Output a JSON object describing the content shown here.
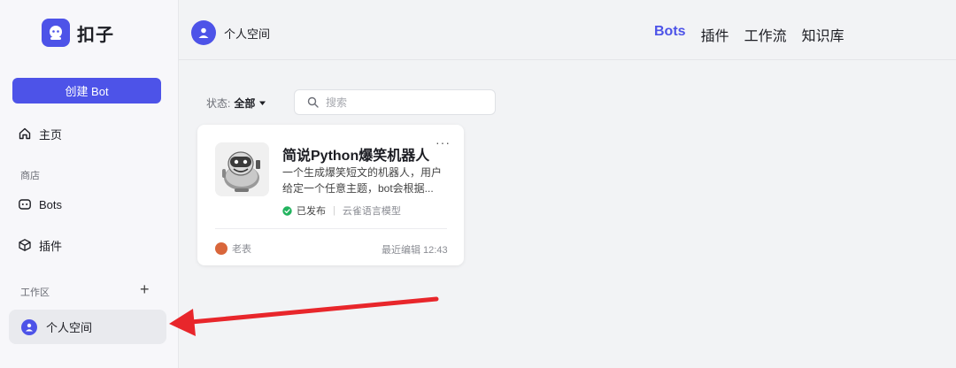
{
  "brand": {
    "name": "扣子",
    "accent": "#4d53e8"
  },
  "sidebar": {
    "create_label": "创建 Bot",
    "home_label": "主页",
    "store_section": "商店",
    "bots_label": "Bots",
    "plugins_label": "插件",
    "workspace_section": "工作区",
    "workspace_item": "个人空间"
  },
  "header": {
    "space_name": "个人空间",
    "tabs": [
      {
        "label": "Bots",
        "active": true
      },
      {
        "label": "插件",
        "active": false
      },
      {
        "label": "工作流",
        "active": false
      },
      {
        "label": "知识库",
        "active": false
      }
    ]
  },
  "filters": {
    "status_label": "状态:",
    "status_value": "全部",
    "search_placeholder": "搜索"
  },
  "card": {
    "title": "简说Python爆笑机器人",
    "more": "···",
    "description": "一个生成爆笑短文的机器人，用户给定一个任意主题，bot会根据...",
    "status": "已发布",
    "model": "云雀语言模型",
    "author": "老表",
    "last_edited": "最近编辑 12:43",
    "status_color": "#22b35e"
  },
  "annotation": {
    "arrow_color": "#e8262b"
  }
}
